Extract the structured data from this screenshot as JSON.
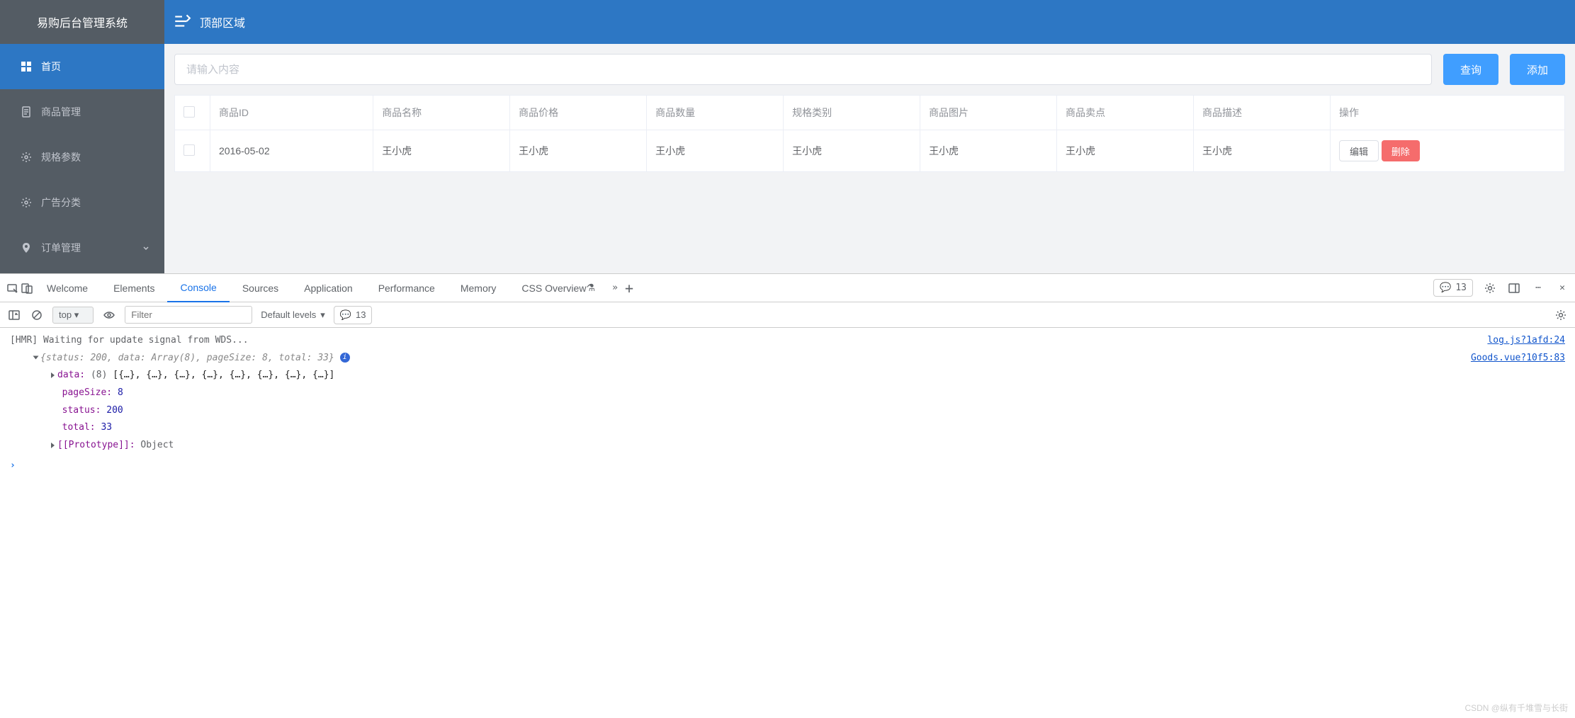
{
  "sidebar": {
    "title": "易购后台管理系统",
    "items": [
      {
        "label": "首页",
        "icon": "grid-icon"
      },
      {
        "label": "商品管理",
        "icon": "document-icon"
      },
      {
        "label": "规格参数",
        "icon": "gear-icon"
      },
      {
        "label": "广告分类",
        "icon": "gear-icon"
      },
      {
        "label": "订单管理",
        "icon": "location-icon",
        "expandable": true
      }
    ]
  },
  "topbar": {
    "title": "顶部区域"
  },
  "toolbar": {
    "search_placeholder": "请输入内容",
    "query_label": "查询",
    "add_label": "添加"
  },
  "table": {
    "headers": [
      "商品ID",
      "商品名称",
      "商品价格",
      "商品数量",
      "规格类别",
      "商品图片",
      "商品卖点",
      "商品描述",
      "操作"
    ],
    "rows": [
      {
        "id": "2016-05-02",
        "name": "王小虎",
        "price": "王小虎",
        "qty": "王小虎",
        "spec": "王小虎",
        "img": "王小虎",
        "sell": "王小虎",
        "desc": "王小虎"
      }
    ],
    "edit_label": "编辑",
    "delete_label": "删除"
  },
  "devtools": {
    "tabs": [
      "Welcome",
      "Elements",
      "Console",
      "Sources",
      "Application",
      "Performance",
      "Memory",
      "CSS Overview"
    ],
    "active_tab": "Console",
    "issue_count": "13",
    "toolbar": {
      "context": "top",
      "filter_placeholder": "Filter",
      "levels": "Default levels",
      "issue_count": "13"
    },
    "console": {
      "hmr_line": "[HMR] Waiting for update signal from WDS...",
      "hmr_link": "log.js?1afd:24",
      "obj_summary": "{status: 200, data: Array(8), pageSize: 8, total: 33}",
      "obj_link": "Goods.vue?10f5:83",
      "data_key": "data:",
      "data_count": "(8)",
      "data_preview": "[{…}, {…}, {…}, {…}, {…}, {…}, {…}, {…}]",
      "pageSize_key": "pageSize:",
      "pageSize_val": "8",
      "status_key": "status:",
      "status_val": "200",
      "total_key": "total:",
      "total_val": "33",
      "proto_key": "[[Prototype]]:",
      "proto_val": "Object"
    }
  },
  "watermark": "CSDN @纵有千堆雪与长街"
}
